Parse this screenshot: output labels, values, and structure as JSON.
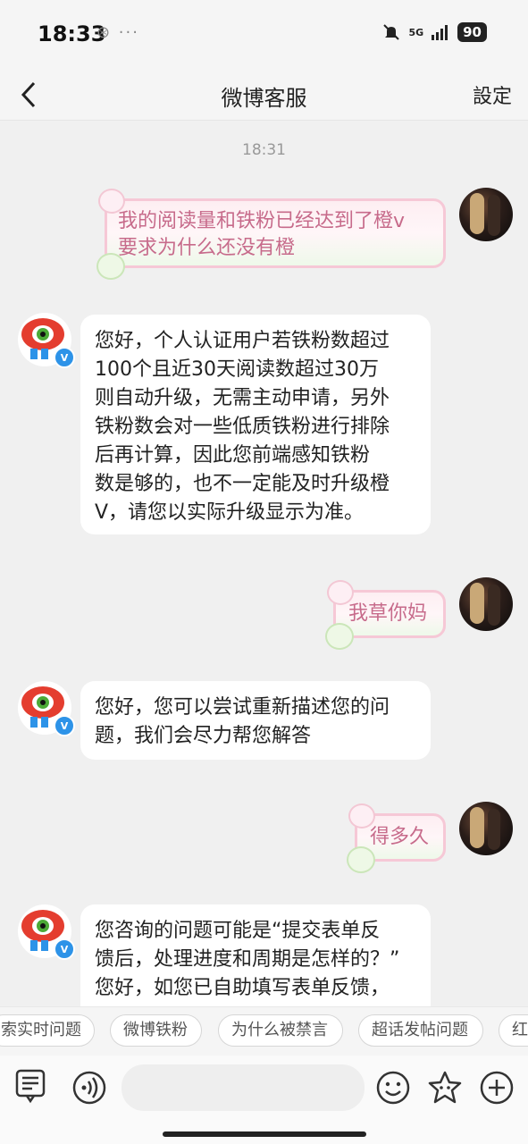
{
  "status": {
    "time": "18:33",
    "extra": "⊛ ···",
    "network": "5G",
    "battery": "90"
  },
  "nav": {
    "title": "微博客服",
    "settings": "設定"
  },
  "chat": {
    "timestamp": "18:31",
    "messages": [
      {
        "from": "user",
        "lines": [
          "我的阅读量和铁粉已经达到了橙v",
          "要求为什么还没有橙"
        ]
      },
      {
        "from": "bot",
        "lines": [
          "您好，个人认证用户若铁粉数超过",
          "100个且近30天阅读数超过30万",
          "则自动升级，无需主动申请，另外",
          "铁粉数会对一些低质铁粉进行排除",
          "后再计算，因此您前端感知铁粉",
          "数是够的，也不一定能及时升级橙",
          "V，请您以实际升级显示为准。"
        ]
      },
      {
        "from": "user",
        "lines": [
          "我草你妈"
        ]
      },
      {
        "from": "bot",
        "lines": [
          "您好，您可以尝试重新描述您的问",
          "题，我们会尽力帮您解答"
        ]
      },
      {
        "from": "user",
        "lines": [
          "得多久"
        ]
      },
      {
        "from": "bot",
        "lines": [
          "您咨询的问题可能是“提交表单反",
          "馈后，处理进度和周期是怎样的？”",
          "您好，如您已自助填写表单反馈，"
        ]
      }
    ]
  },
  "quick_replies": [
    "索实时问题",
    "微博铁粉",
    "为什么被禁言",
    "超话发帖问题",
    "红"
  ],
  "input": {
    "placeholder": ""
  },
  "icons": [
    "back-icon",
    "menu-icon",
    "voice-icon",
    "emoji-icon",
    "sticker-icon",
    "add-icon"
  ],
  "colors": {
    "user_text": "#c76b8b",
    "verified_badge": "#2d93e8",
    "bot_mascot": "#e43d2f"
  }
}
